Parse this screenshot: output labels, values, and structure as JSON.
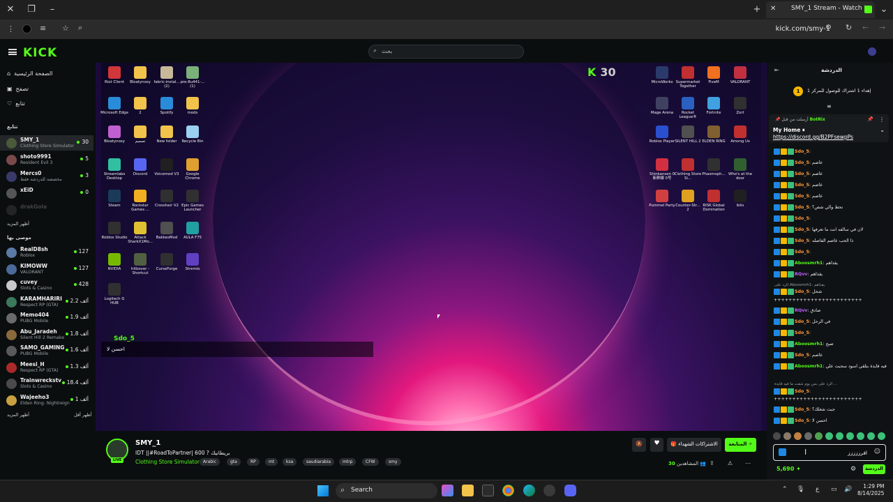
{
  "browser": {
    "tab_title": "SMY_1 Stream - Watch Live",
    "url": "kick.com/smy-1"
  },
  "header": {
    "logo": "KICK",
    "search_placeholder": "بحث"
  },
  "sidebar": {
    "nav": [
      {
        "label": "الصفحة الرئيسية",
        "icon": "home-icon"
      },
      {
        "label": "تصفح",
        "icon": "browse-icon"
      },
      {
        "label": "تتابع",
        "icon": "heart-icon"
      }
    ],
    "following_title": "تتابع",
    "following": [
      {
        "name": "SMY_1",
        "sub": "Clothing Store Simulator",
        "viewers": "30",
        "color": "#4a5a3a"
      },
      {
        "name": "shoto9991",
        "sub": "Resident Evil 3",
        "viewers": "5",
        "color": "#7a4a4a"
      },
      {
        "name": "Mercs0",
        "sub": "مخصصة للدردشة فقط",
        "viewers": "3",
        "color": "#3a3a6a"
      },
      {
        "name": "xEiD",
        "sub": "",
        "viewers": "0",
        "color": "#555555"
      },
      {
        "name": "drakGola",
        "sub": "",
        "viewers": "",
        "color": "#333333"
      }
    ],
    "show_more_1": "أظهر المزيد",
    "recommended_title": "موصى بها",
    "recommended": [
      {
        "name": "RealD8sh",
        "sub": "Roblox",
        "viewers": "127",
        "color": "#5a7aa8"
      },
      {
        "name": "KIMOWW",
        "sub": "VALORANT",
        "viewers": "127",
        "color": "#4a6a9a"
      },
      {
        "name": "cuvey",
        "sub": "Slots & Casino",
        "viewers": "428",
        "color": "#c8c8c8"
      },
      {
        "name": "KARAMHARIRI",
        "sub": "Respect RP (GTA)",
        "viewers": "2.2 ألف",
        "color": "#3a7a5a"
      },
      {
        "name": "Memo404",
        "sub": "PUBG Mobile",
        "viewers": "1.9 ألف",
        "color": "#6a6a6a"
      },
      {
        "name": "Abu_Jaradeh",
        "sub": "Silent Hill 2 Remake",
        "viewers": "1.8 ألف",
        "color": "#8a6a3a"
      },
      {
        "name": "SAMO_GAMING",
        "sub": "PUBG Mobile",
        "viewers": "1.6 ألف",
        "color": "#5a5a5a"
      },
      {
        "name": "Meesi_H",
        "sub": "Respect RP (GTA)",
        "viewers": "1.3 ألف",
        "color": "#aa2a2a"
      },
      {
        "name": "Trainwreckstv",
        "sub": "Slots & Casino",
        "viewers": "18.4 ألف",
        "color": "#4a4a4a"
      },
      {
        "name": "Wajeeho3",
        "sub": "Elden Ring: Nightreign",
        "viewers": "1 ألف",
        "color": "#c8a040"
      }
    ],
    "show_more_2": "أظهر المزيد",
    "show_less": "أظهر أقل"
  },
  "video": {
    "kick_badge_count": "30",
    "overlay_user": "Sdo_5",
    "overlay_msg": "احسن لا",
    "desktop_icons": [
      {
        "label": "Riot Client",
        "color": "#d13639"
      },
      {
        "label": "Bloatynosy",
        "color": "#f2c34a"
      },
      {
        "label": "fabric-instal... (2)",
        "color": "#c8b89a"
      },
      {
        "label": "pre-8u441-... (1)",
        "color": "#7ab07a"
      },
      {
        "label": "Microsoft Edge",
        "color": "#2a8cd8"
      },
      {
        "label": "2",
        "color": "#f2c34a"
      },
      {
        "label": "Spotify",
        "color": "#2a8cd8"
      },
      {
        "label": "mods",
        "color": "#f2c34a"
      },
      {
        "label": "Bloatynosy",
        "color": "#c060d0"
      },
      {
        "label": "تصميم",
        "color": "#f2c34a"
      },
      {
        "label": "New folder",
        "color": "#f2c34a"
      },
      {
        "label": "Recycle Bin",
        "color": "#9ad0f0"
      },
      {
        "label": "Streamlabs Desktop",
        "color": "#30c0a0"
      },
      {
        "label": "Discord",
        "color": "#5865f2"
      },
      {
        "label": "Voicemod V3",
        "color": "#202020"
      },
      {
        "label": "Google Chrome",
        "color": "#e0a030"
      },
      {
        "label": "Steam",
        "color": "#1b3a5a"
      },
      {
        "label": "Rockstar Games ...",
        "color": "#f0b020"
      },
      {
        "label": "Crosshair V2",
        "color": "#303030"
      },
      {
        "label": "Epic Games Launcher",
        "color": "#303030"
      },
      {
        "label": "Roblox Studio",
        "color": "#303030"
      },
      {
        "label": "Attack SharkX1Mo...",
        "color": "#e0c030"
      },
      {
        "label": "BakkesMod",
        "color": "#505050"
      },
      {
        "label": "AULA F75",
        "color": "#20a0a0"
      },
      {
        "label": "NVIDIA",
        "color": "#76b900"
      },
      {
        "label": "hitbover - Shortcut",
        "color": "#506040"
      },
      {
        "label": "CurseForge",
        "color": "#303030"
      },
      {
        "label": "Stremio",
        "color": "#6040c0"
      },
      {
        "label": "Logitech G HUB",
        "color": "#303030"
      }
    ],
    "desktop_icons_right": [
      {
        "label": "MicroWorks",
        "color": "#2a3a6a"
      },
      {
        "label": "Supermarket Together",
        "color": "#c03030"
      },
      {
        "label": "FiveM",
        "color": "#f07020"
      },
      {
        "label": "VALORANT",
        "color": "#c03040"
      },
      {
        "label": "Mage Arena",
        "color": "#404060"
      },
      {
        "label": "Rocket League®",
        "color": "#2a60c0"
      },
      {
        "label": "Fortnite",
        "color": "#40a0e0"
      },
      {
        "label": "Zort",
        "color": "#303030"
      },
      {
        "label": "Roblox Player",
        "color": "#2a50d0"
      },
      {
        "label": "SILENT HILL 2",
        "color": "#505050"
      },
      {
        "label": "ELDEN RING",
        "color": "#806030"
      },
      {
        "label": "Among Us",
        "color": "#c03030"
      },
      {
        "label": "Shinkansen 0 新幹線 0号",
        "color": "#d03040"
      },
      {
        "label": "Clothing Store Si...",
        "color": "#c03030"
      },
      {
        "label": "Phasmoph...",
        "color": "#303030"
      },
      {
        "label": "Who's at the door",
        "color": "#306030"
      },
      {
        "label": "Pummel Party",
        "color": "#d04040"
      },
      {
        "label": "Counter-Str... 2",
        "color": "#e0a020"
      },
      {
        "label": "RISK Global Domination",
        "color": "#c03030"
      },
      {
        "label": "iblis",
        "color": "#202020"
      }
    ]
  },
  "stream": {
    "streamer": "SMY_1",
    "live": "LIVE",
    "title": "IDT ||#RoadToPartner| 600 ? بريطانيك",
    "category": "Clothing Store Simulator",
    "tags": [
      "Arabic",
      "gta",
      "RP",
      "mt",
      "ksa",
      "saudiarabia",
      "mtrp",
      "CFW",
      "smy"
    ],
    "follow_label": "المتابعة",
    "gift_label": "الاشتراكات الشهداء",
    "viewers_label": "المشاهدين",
    "viewers_count": "30"
  },
  "chat": {
    "title": "الدردشة",
    "pin_bar": "إهداء 1 اشتراك للوصول للمركز 1",
    "pin_bar_rank": "1",
    "pinned_by_label": "أرسلت من قبل",
    "pinned_by": "BotRix",
    "pinned_heading": "My Home ⏸",
    "pinned_link": "https://discord.gg/B2PFsewpPs",
    "messages": [
      {
        "user": "Sdo_5",
        "color": "#ff9a3c",
        "text": ""
      },
      {
        "user": "Sdo_5",
        "color": "#ff9a3c",
        "text": "عاصم"
      },
      {
        "user": "Sdo_5",
        "color": "#ff9a3c",
        "text": "عاصم"
      },
      {
        "user": "Sdo_5",
        "color": "#ff9a3c",
        "text": "عاصم"
      },
      {
        "user": "Sdo_5",
        "color": "#ff9a3c",
        "text": "عاصم"
      },
      {
        "user": "Sdo_5",
        "color": "#ff9a3c",
        "text": "تحط والي شص؟"
      },
      {
        "user": "Sdo_5",
        "color": "#ff9a3c",
        "text": ""
      },
      {
        "user": "Sdo_5",
        "color": "#ff9a3c",
        "text": "لان في سالفه انت ما تعرفها"
      },
      {
        "user": "Sdo_5",
        "color": "#ff9a3c",
        "text": "ذا الحب عاصم الفاصله"
      },
      {
        "user": "Sdo_5",
        "color": "#ff9a3c",
        "text": ""
      },
      {
        "user": "Aboosmrh1",
        "color": "#53fc18",
        "text": "يقذاهم"
      },
      {
        "user": "RQvv",
        "color": "#c060ff",
        "text": "يقذاهم"
      }
    ],
    "reply_1": "الرد على Aboosmrh1: يقذاهم",
    "messages2": [
      {
        "user": "Sdo_5",
        "color": "#ff9a3c",
        "text": "شحل"
      },
      {
        "user": "",
        "color": "#ffffff",
        "text": "++++++++++++++++++++++++"
      },
      {
        "user": "RQvv",
        "color": "#c060ff",
        "text": "صادق"
      },
      {
        "user": "Sdo_5",
        "color": "#ff9a3c",
        "text": "في الرحل"
      },
      {
        "user": "Sdo_5",
        "color": "#ff9a3c",
        "text": ""
      },
      {
        "user": "Aboosmrh1",
        "color": "#53fc18",
        "text": "صبح"
      },
      {
        "user": "Sdo_5",
        "color": "#ff9a3c",
        "text": "عاصم"
      },
      {
        "user": "Aboosmrh1",
        "color": "#53fc18",
        "text": "بس يوم شفت ما فيه فايدة بتلقي اسود سحبت علي"
      }
    ],
    "reply_2": "الرد على بس يوم شفت ما فيه فايدة ...",
    "messages3": [
      {
        "user": "Sdo_5",
        "color": "#ff9a3c",
        "text": ""
      },
      {
        "user": "",
        "color": "#ffffff",
        "text": "++++++++++++++++++++++++"
      },
      {
        "user": "Sdo_5",
        "color": "#ff9a3c",
        "text": "جبت شغلك؟"
      },
      {
        "user": "Sdo_5",
        "color": "#ff9a3c",
        "text": "احسن لا"
      }
    ],
    "input_value": "افرززززز",
    "send_label": "الدردشة",
    "points": "5,690"
  },
  "taskbar": {
    "search_label": "Search",
    "time": "1:29 PM",
    "date": "8/14/2025",
    "lang": "ع"
  }
}
